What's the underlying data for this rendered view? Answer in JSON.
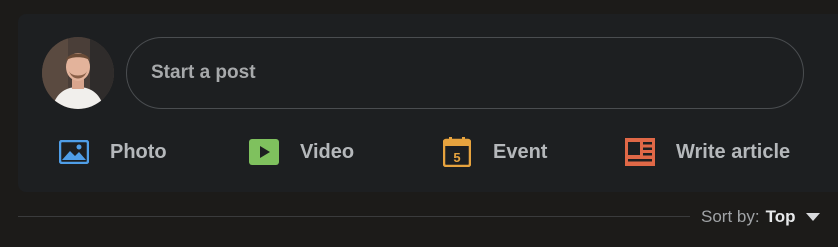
{
  "composer": {
    "avatar_icon": "user-avatar",
    "placeholder": "Start a post"
  },
  "actions": [
    {
      "label": "Photo",
      "icon": "photo-icon",
      "color": "#4f9ee8"
    },
    {
      "label": "Video",
      "icon": "video-icon",
      "color": "#7fc15e"
    },
    {
      "label": "Event",
      "icon": "calendar-icon",
      "color": "#e7a33e",
      "icon_text": "5"
    },
    {
      "label": "Write article",
      "icon": "article-icon",
      "color": "#e06847"
    }
  ],
  "feed": {
    "sort_label": "Sort by:",
    "sort_value": "Top"
  }
}
